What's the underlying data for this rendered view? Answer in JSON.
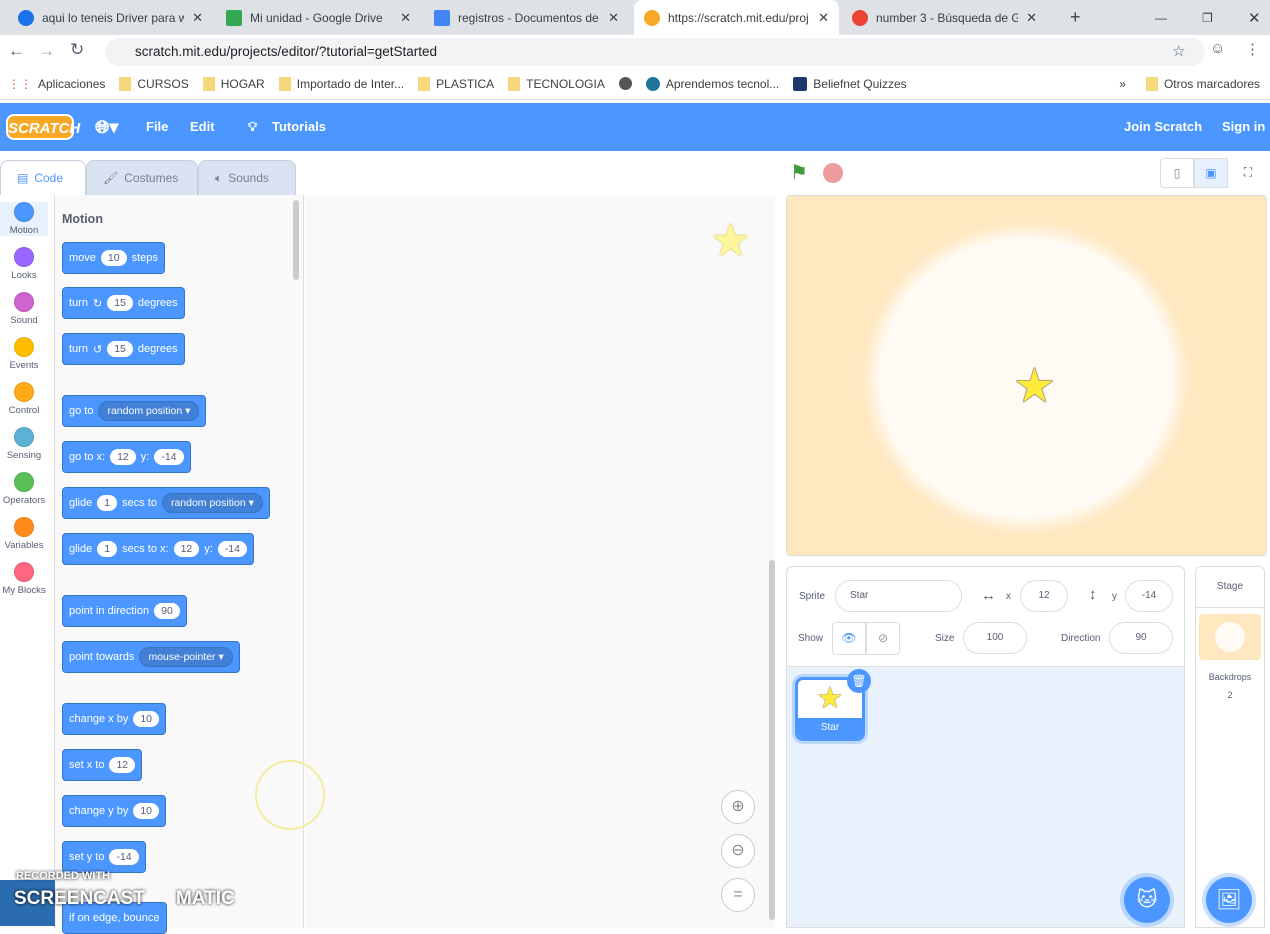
{
  "browser": {
    "tabs": [
      {
        "title": "aqui lo teneis Driver para w"
      },
      {
        "title": "Mi unidad - Google Drive"
      },
      {
        "title": "registros - Documentos de"
      },
      {
        "title": "https://scratch.mit.edu/proj"
      },
      {
        "title": "number 3 - Búsqueda de G"
      }
    ],
    "url": "scratch.mit.edu/projects/editor/?tutorial=getStarted",
    "bookmarks": [
      "Aplicaciones",
      "CURSOS",
      "HOGAR",
      "Importado de Inter...",
      "PLASTICA",
      "TECNOLOGIA",
      "Aprendemos tecnol...",
      "Beliefnet Quizzes"
    ],
    "other_bookmarks": "Otros marcadores"
  },
  "menu": {
    "logo": "SCRATCH",
    "file": "File",
    "edit": "Edit",
    "tutorials": "Tutorials",
    "join": "Join Scratch",
    "signin": "Sign in"
  },
  "editor_tabs": {
    "code": "Code",
    "costumes": "Costumes",
    "sounds": "Sounds"
  },
  "categories": [
    {
      "label": "Motion",
      "color": "#4c97ff"
    },
    {
      "label": "Looks",
      "color": "#9966ff"
    },
    {
      "label": "Sound",
      "color": "#cf63cf"
    },
    {
      "label": "Events",
      "color": "#ffbf00"
    },
    {
      "label": "Control",
      "color": "#ffab19"
    },
    {
      "label": "Sensing",
      "color": "#5cb1d6"
    },
    {
      "label": "Operators",
      "color": "#59c059"
    },
    {
      "label": "Variables",
      "color": "#ff8c1a"
    },
    {
      "label": "My Blocks",
      "color": "#ff6680"
    }
  ],
  "palette": {
    "heading": "Motion",
    "blocks": [
      [
        [
          "t",
          "move"
        ],
        [
          "n",
          "10"
        ],
        [
          "t",
          "steps"
        ]
      ],
      [
        [
          "t",
          "turn"
        ],
        [
          "t",
          "↻"
        ],
        [
          "n",
          "15"
        ],
        [
          "t",
          "degrees"
        ]
      ],
      [
        [
          "t",
          "turn"
        ],
        [
          "t",
          "↺"
        ],
        [
          "n",
          "15"
        ],
        [
          "t",
          "degrees"
        ]
      ],
      [
        [
          "t",
          "go to"
        ],
        [
          "d",
          "random position ▾"
        ]
      ],
      [
        [
          "t",
          "go to x:"
        ],
        [
          "n",
          "12"
        ],
        [
          "t",
          "y:"
        ],
        [
          "n",
          "-14"
        ]
      ],
      [
        [
          "t",
          "glide"
        ],
        [
          "n",
          "1"
        ],
        [
          "t",
          "secs to"
        ],
        [
          "d",
          "random position ▾"
        ]
      ],
      [
        [
          "t",
          "glide"
        ],
        [
          "n",
          "1"
        ],
        [
          "t",
          "secs to x:"
        ],
        [
          "n",
          "12"
        ],
        [
          "t",
          "y:"
        ],
        [
          "n",
          "-14"
        ]
      ],
      [
        [
          "t",
          "point in direction"
        ],
        [
          "n",
          "90"
        ]
      ],
      [
        [
          "t",
          "point towards"
        ],
        [
          "d",
          "mouse-pointer ▾"
        ]
      ],
      [
        [
          "t",
          "change x by"
        ],
        [
          "n",
          "10"
        ]
      ],
      [
        [
          "t",
          "set x to"
        ],
        [
          "n",
          "12"
        ]
      ],
      [
        [
          "t",
          "change y by"
        ],
        [
          "n",
          "10"
        ]
      ],
      [
        [
          "t",
          "set y to"
        ],
        [
          "n",
          "-14"
        ]
      ],
      [
        [
          "t",
          "if on edge, bounce"
        ]
      ]
    ]
  },
  "sprite_info": {
    "sprite_label": "Sprite",
    "sprite_name": "Star",
    "x_label": "x",
    "x": "12",
    "y_label": "y",
    "y": "-14",
    "show_label": "Show",
    "size_label": "Size",
    "size": "100",
    "direction_label": "Direction",
    "direction": "90"
  },
  "sprites": [
    {
      "name": "Star"
    }
  ],
  "stage_panel": {
    "title": "Stage",
    "backdrops_label": "Backdrops",
    "backdrops_count": "2"
  },
  "watermark": {
    "line1": "RECORDED WITH",
    "line2": "SCREENCAST",
    "line3": "MATIC"
  }
}
